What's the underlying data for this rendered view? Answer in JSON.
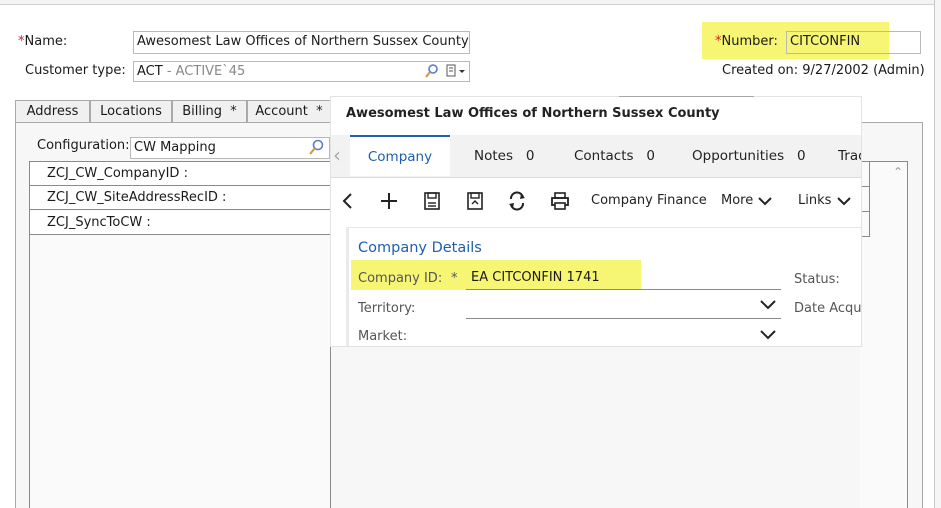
{
  "header": {
    "name_label": "Name:",
    "name_value": "Awesomest Law Offices of Northern Sussex County",
    "customer_type_label": "Customer type:",
    "customer_type_code": "ACT",
    "customer_type_desc": " - ACTIVE`45",
    "number_label": "Number:",
    "number_value": "CITCONFIN",
    "created_on": "Created on: 9/27/2002 (Admin)",
    "required_mark": "*"
  },
  "tabs": [
    {
      "label": "Address"
    },
    {
      "label": "Locations"
    },
    {
      "label": "Billing  *"
    },
    {
      "label": "Account  *"
    }
  ],
  "config": {
    "label": "Configuration:",
    "value": "CW Mapping"
  },
  "mapping_rows": [
    {
      "label": "ZCJ_CW_CompanyID :"
    },
    {
      "label": "ZCJ_CW_SiteAddressRecID :"
    },
    {
      "label": "ZCJ_SyncToCW :"
    }
  ],
  "overlay": {
    "title": "Awesomest Law Offices of Northern Sussex County",
    "tabs": [
      {
        "label": "Company"
      },
      {
        "label": "Notes   0"
      },
      {
        "label": "Contacts   0"
      },
      {
        "label": "Opportunities   0"
      },
      {
        "label": "Trac"
      }
    ],
    "toolbar": {
      "company_finance": "Company Finance",
      "more": "More",
      "links": "Links"
    },
    "section_title": "Company Details",
    "company_id_label": "Company ID:",
    "company_id_required": "*",
    "company_id_value": "EA CITCONFIN 1741",
    "territory_label": "Territory:",
    "market_label": "Market:",
    "status_label": "Status:",
    "date_acq_label": "Date Acqui"
  },
  "colors": {
    "highlight": "#f7f574",
    "accent": "#1f5fae",
    "required": "#d21e1e"
  }
}
